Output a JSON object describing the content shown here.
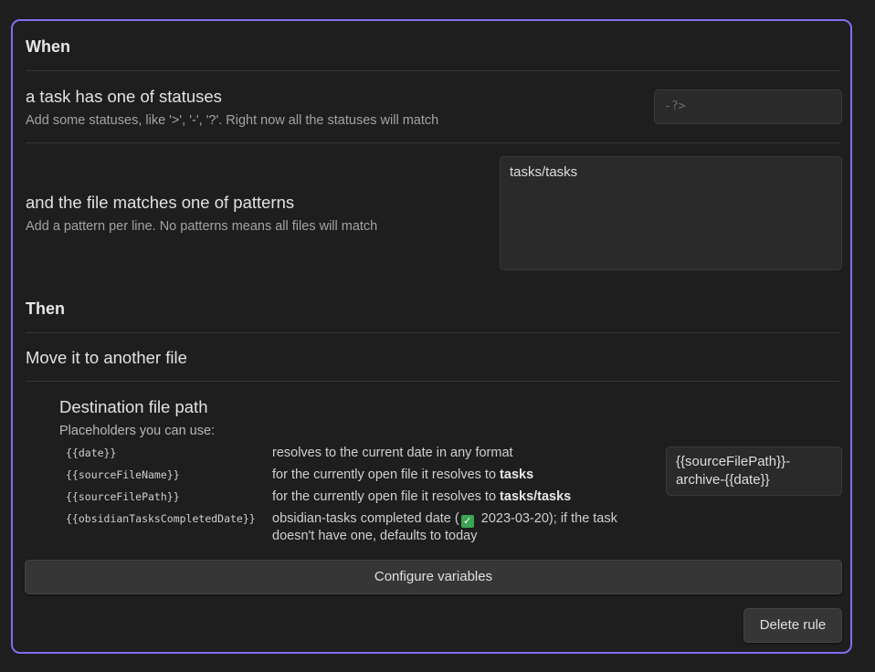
{
  "when": {
    "heading": "When",
    "statuses": {
      "title": "a task has one of statuses",
      "description": "Add some statuses, like '>', '-', '?'. Right now all the statuses will match",
      "placeholder": "-?>"
    },
    "patterns": {
      "title": "and the file matches one of patterns",
      "description": "Add a pattern per line. No patterns means all files will match",
      "value": "tasks/tasks"
    }
  },
  "then": {
    "heading": "Then",
    "action_label": "Move it to another file",
    "destination": {
      "title": "Destination file path",
      "placeholders_intro": "Placeholders you can use:",
      "placeholders": [
        {
          "key": "{{date}}",
          "before": "resolves to the current date in any format",
          "bold": ""
        },
        {
          "key": "{{sourceFileName}}",
          "before": "for the currently open file it resolves to ",
          "bold": "tasks"
        },
        {
          "key": "{{sourceFilePath}}",
          "before": "for the currently open file it resolves to ",
          "bold": "tasks/tasks"
        },
        {
          "key": "{{obsidianTasksCompletedDate}}",
          "before": "obsidian-tasks completed date (",
          "check_icon": "check-mark-icon",
          "after": " 2023-03-20); if the task doesn't have one, defaults to today"
        }
      ],
      "value": "{{sourceFilePath}}-archive-{{date}}"
    }
  },
  "buttons": {
    "configure_variables": "Configure variables",
    "delete_rule": "Delete rule"
  },
  "colors": {
    "accent": "#7f6df2",
    "background": "#1e1e1e",
    "check": "#3aa655"
  }
}
